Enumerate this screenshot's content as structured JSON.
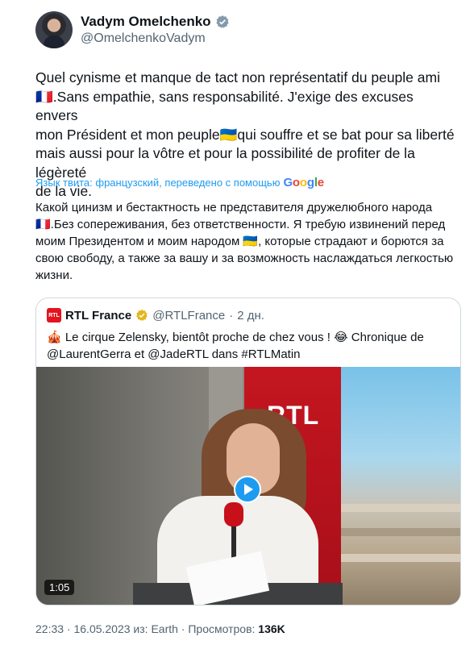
{
  "author": {
    "display_name": "Vadym Omelchenko",
    "handle": "@OmelchenkoVadym",
    "verified_color": "#1d9bf0"
  },
  "tweet": {
    "lines": [
      "Quel cynisme et manque de tact non représentatif du peuple ami",
      "🇫🇷.Sans empathie, sans responsabilité. J'exige des excuses envers",
      "mon Président et mon peuple🇺🇦qui souffre et se bat pour sa liberté",
      "mais aussi pour la vôtre et pour la possibilité de profiter de la légèreté",
      "de la vie."
    ]
  },
  "translation": {
    "label": "Язык твита: французский, переведено с помощью",
    "provider": "Google",
    "lines": [
      "Какой цинизм и бестактность не представителя дружелюбного народа",
      "🇫🇷.Без сопереживания, без ответственности. Я требую извинений перед",
      "моим Президентом и моим народом 🇺🇦, которые страдают и борются за",
      "свою свободу, а также за вашу и за возможность наслаждаться легкостью",
      "жизни."
    ]
  },
  "quoted": {
    "avatar_text": "RTL",
    "name": "RTL France",
    "handle": "@RTLFrance",
    "separator": "·",
    "time": "2 дн.",
    "text_lines": [
      "🎪 Le cirque Zelensky, bientôt proche de chez vous ! 😂 Chronique de",
      "@LaurentGerra et @JadeRTL dans #RTLMatin"
    ],
    "video": {
      "backdrop_logo": "RTL",
      "duration": "1:05"
    }
  },
  "footer": {
    "meta": "22:33 · 16.05.2023 из: Earth · Просмотров: ",
    "views": "136K"
  },
  "colors": {
    "accent": "#1d9bf0",
    "rtl_red": "#e3141d",
    "muted": "#536471"
  }
}
